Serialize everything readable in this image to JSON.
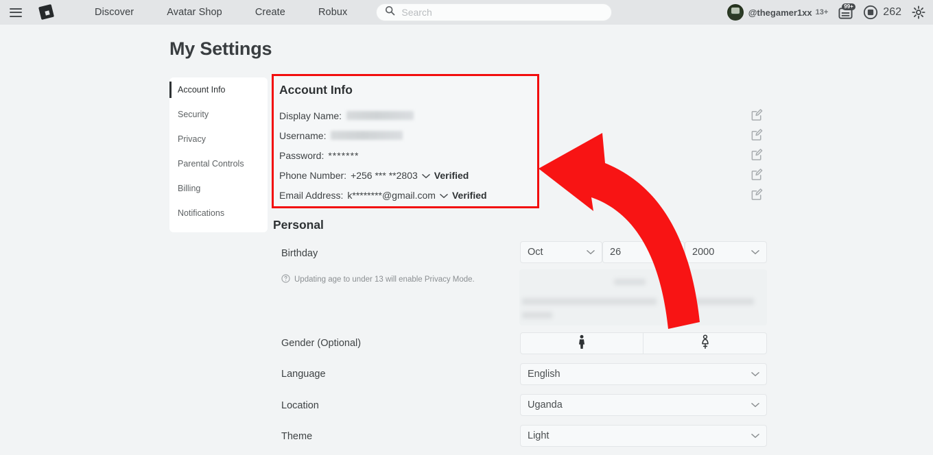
{
  "topnav": {
    "menu_icon": "hamburger-icon",
    "logo_icon": "roblox-logo-icon",
    "links": [
      "Discover",
      "Avatar Shop",
      "Create",
      "Robux"
    ],
    "search": {
      "placeholder": "Search",
      "value": "",
      "icon": "search-icon"
    },
    "user": {
      "handle": "@thegamer1xx",
      "age_badge": "13+",
      "avatar_icon": "avatar"
    },
    "notifications": {
      "icon": "notifications-icon",
      "badge": "99+"
    },
    "robux": {
      "icon": "robux-icon",
      "amount": "262"
    },
    "settings_icon": "gear-icon"
  },
  "page": {
    "title": "My Settings"
  },
  "sidebar": {
    "items": [
      {
        "label": "Account Info",
        "active": true
      },
      {
        "label": "Security",
        "active": false
      },
      {
        "label": "Privacy",
        "active": false
      },
      {
        "label": "Parental Controls",
        "active": false
      },
      {
        "label": "Billing",
        "active": false
      },
      {
        "label": "Notifications",
        "active": false
      }
    ]
  },
  "account_info": {
    "title": "Account Info",
    "highlight_color": "#f20d0d",
    "rows": [
      {
        "label": "Display Name:",
        "value": "",
        "redacted": true,
        "verified": ""
      },
      {
        "label": "Username:",
        "value": "",
        "redacted": true,
        "verified": ""
      },
      {
        "label": "Password:",
        "value": "*******",
        "redacted": false,
        "verified": ""
      },
      {
        "label": "Phone Number:",
        "value": "+256 *** **2803",
        "redacted": false,
        "verified": "Verified"
      },
      {
        "label": "Email Address:",
        "value": "k********@gmail.com",
        "redacted": false,
        "verified": "Verified"
      }
    ],
    "edit_icon": "edit-icon",
    "edit_count": 5
  },
  "personal": {
    "title": "Personal",
    "birthday": {
      "label": "Birthday",
      "month": "Oct",
      "day": "26",
      "year": "2000"
    },
    "hint": {
      "icon": "question-mark-icon",
      "text": "Updating age to under 13 will enable Privacy Mode."
    },
    "gender": {
      "label": "Gender (Optional)",
      "options": [
        {
          "icon": "male-figure-icon"
        },
        {
          "icon": "female-figure-icon"
        }
      ]
    },
    "language": {
      "label": "Language",
      "value": "English"
    },
    "location": {
      "label": "Location",
      "value": "Uganda"
    },
    "theme": {
      "label": "Theme",
      "value": "Light"
    }
  },
  "annotation": {
    "arrow_icon": "curved-arrow-icon",
    "arrow_color": "#f81414"
  }
}
